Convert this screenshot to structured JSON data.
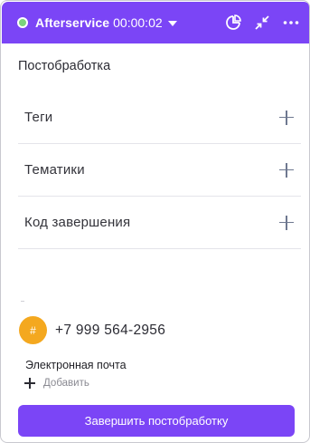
{
  "header": {
    "title": "Afterservice",
    "timer": "00:00:02",
    "status_color": "#7bd37d",
    "accent": "#7b45f6",
    "icons": [
      "status-dot",
      "caret-down-icon",
      "pie-chart-icon",
      "collapse-icon",
      "more-icon"
    ]
  },
  "section": {
    "title": "Постобработка",
    "rows": [
      {
        "label": "Теги"
      },
      {
        "label": "Тематики"
      },
      {
        "label": "Код завершения"
      }
    ]
  },
  "contact": {
    "avatar_text": "#",
    "avatar_color": "#f4a81f",
    "phone": "+7 999 564-2956",
    "email_title": "Электронная почта",
    "add_label": "Добавить"
  },
  "footer": {
    "finish_label": "Завершить постобработку"
  }
}
